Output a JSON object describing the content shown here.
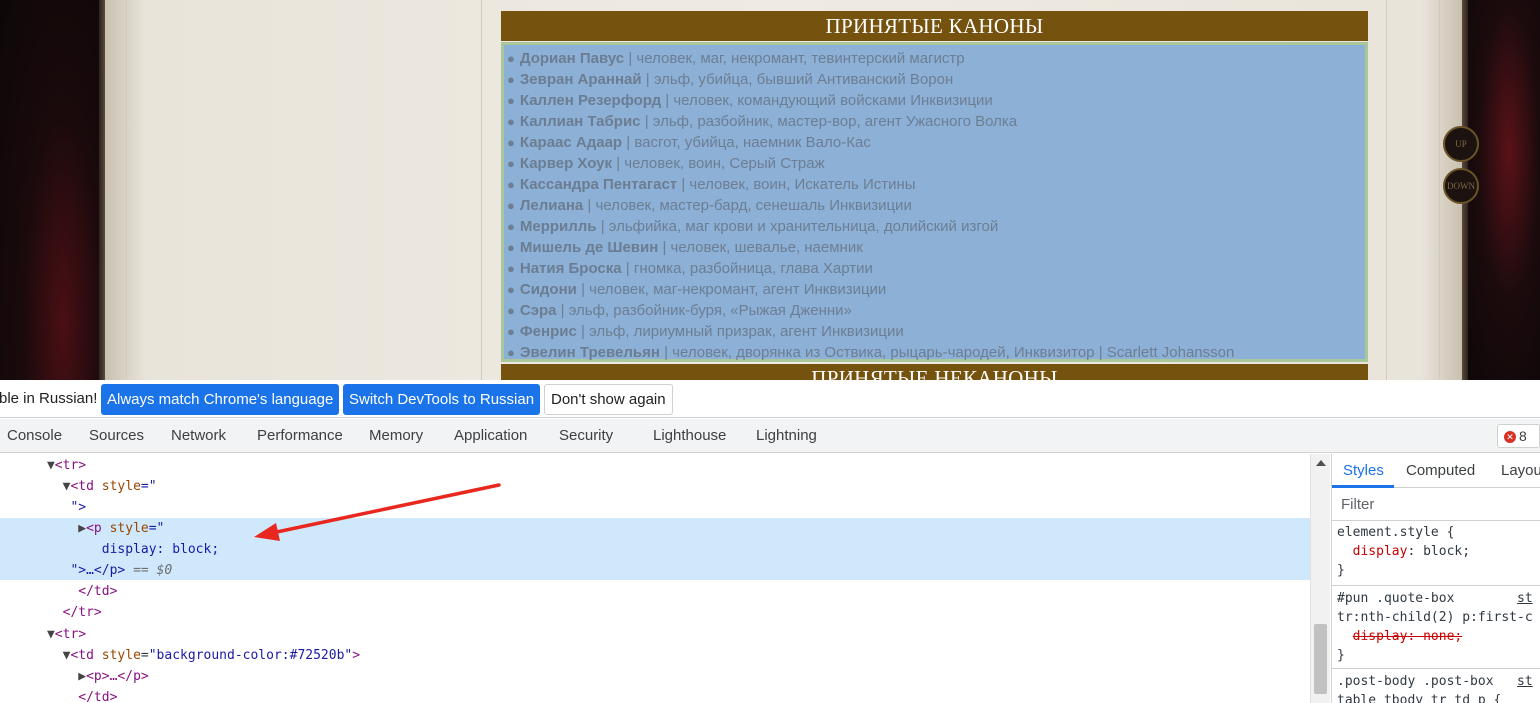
{
  "webpage": {
    "heading_top": "ПРИНЯТЫЕ КАНОНЫ",
    "heading_bottom": "ПРИНЯТЫЕ НЕКАНОНЫ",
    "nav_up": "UP",
    "nav_down": "DOWN",
    "separator": "|",
    "bullet": "●",
    "characters": [
      {
        "name": "Дориан Павус",
        "desc": "человек, маг, некромант, тевинтерский магистр"
      },
      {
        "name": "Зевран Араннай",
        "desc": "эльф, убийца, бывший Антиванский Ворон"
      },
      {
        "name": "Каллен Резерфорд",
        "desc": "человек, командующий войсками Инквизиции"
      },
      {
        "name": "Каллиан Табрис",
        "desc": "эльф, разбойник, мастер-вор, агент Ужасного Волка"
      },
      {
        "name": "Караас Адаар",
        "desc": "васгот, убийца, наемник Вало-Кас"
      },
      {
        "name": "Карвер Хоук",
        "desc": "человек, воин, Серый Страж"
      },
      {
        "name": "Кассандра Пентагаст",
        "desc": "человек, воин, Искатель Истины"
      },
      {
        "name": "Лелиана",
        "desc": "человек, мастер-бард, сенешаль Инквизиции"
      },
      {
        "name": "Меррилль",
        "desc": "эльфийка, маг крови и хранительница, долийский изгой"
      },
      {
        "name": "Мишель де Шевин",
        "desc": "человек, шевалье, наемник"
      },
      {
        "name": "Натия Броска",
        "desc": "гномка, разбойница, глава Хартии"
      },
      {
        "name": "Сидони",
        "desc": "человек, маг-некромант, агент Инквизиции"
      },
      {
        "name": "Сэра",
        "desc": "эльф, разбойник-буря, «Рыжая Дженни»"
      },
      {
        "name": "Фенрис",
        "desc": "эльф, лириумный призрак, агент Инквизиции"
      },
      {
        "name": "Эвелин Тревельян",
        "desc": "человек, дворянка из Оствика, рыцарь-чародей, Инквизитор | Scarlett Johansson"
      }
    ]
  },
  "language_bar": {
    "message": "ble in Russian!",
    "always_match": "Always match Chrome's language",
    "switch": "Switch DevTools to Russian",
    "dont_show": "Don't show again"
  },
  "devtools_tabs": [
    "Console",
    "Sources",
    "Network",
    "Performance",
    "Memory",
    "Application",
    "Security",
    "Lighthouse",
    "Lightning"
  ],
  "error_count": "8",
  "elements": {
    "tr_open": "<tr>",
    "td_open": "<td",
    "style_attr": "style",
    "eq_quote": "=\"",
    "quote_close": "\">",
    "p_open": "<p",
    "display_block": "display: block;",
    "p_close_line": "\">…</p>",
    "dollar0": "== $0",
    "td_close": "</td>",
    "tr_close": "</tr>",
    "td_bg_attr_value": "\"background-color:#72520b\"",
    "td_bg_close": ">",
    "p_collapsed": "<p>…</p>",
    "td_close_partial": "</td>"
  },
  "styles_panel": {
    "tabs": [
      "Styles",
      "Computed",
      "Layou"
    ],
    "filter_placeholder": "Filter",
    "element_style": "element.style {",
    "display_prop": "display",
    "display_val": ": block;",
    "close_brace": "}",
    "rule2_selector": "#pun .quote-box",
    "rule2_source": "st",
    "rule2_selector_line2": "tr:nth-child(2) p:first-c",
    "rule2_prop": "display: none;",
    "rule3_selector": ".post-body .post-box",
    "rule3_source": "st",
    "rule3_selector_line2": "table tbody tr td p {"
  },
  "colors": {
    "heading_bg": "#76520f",
    "list_bg": "#8db0d6",
    "highlight_row": "#cfe8fc",
    "primary_button": "#1a73e8",
    "annotation_arrow": "#e8281f"
  }
}
